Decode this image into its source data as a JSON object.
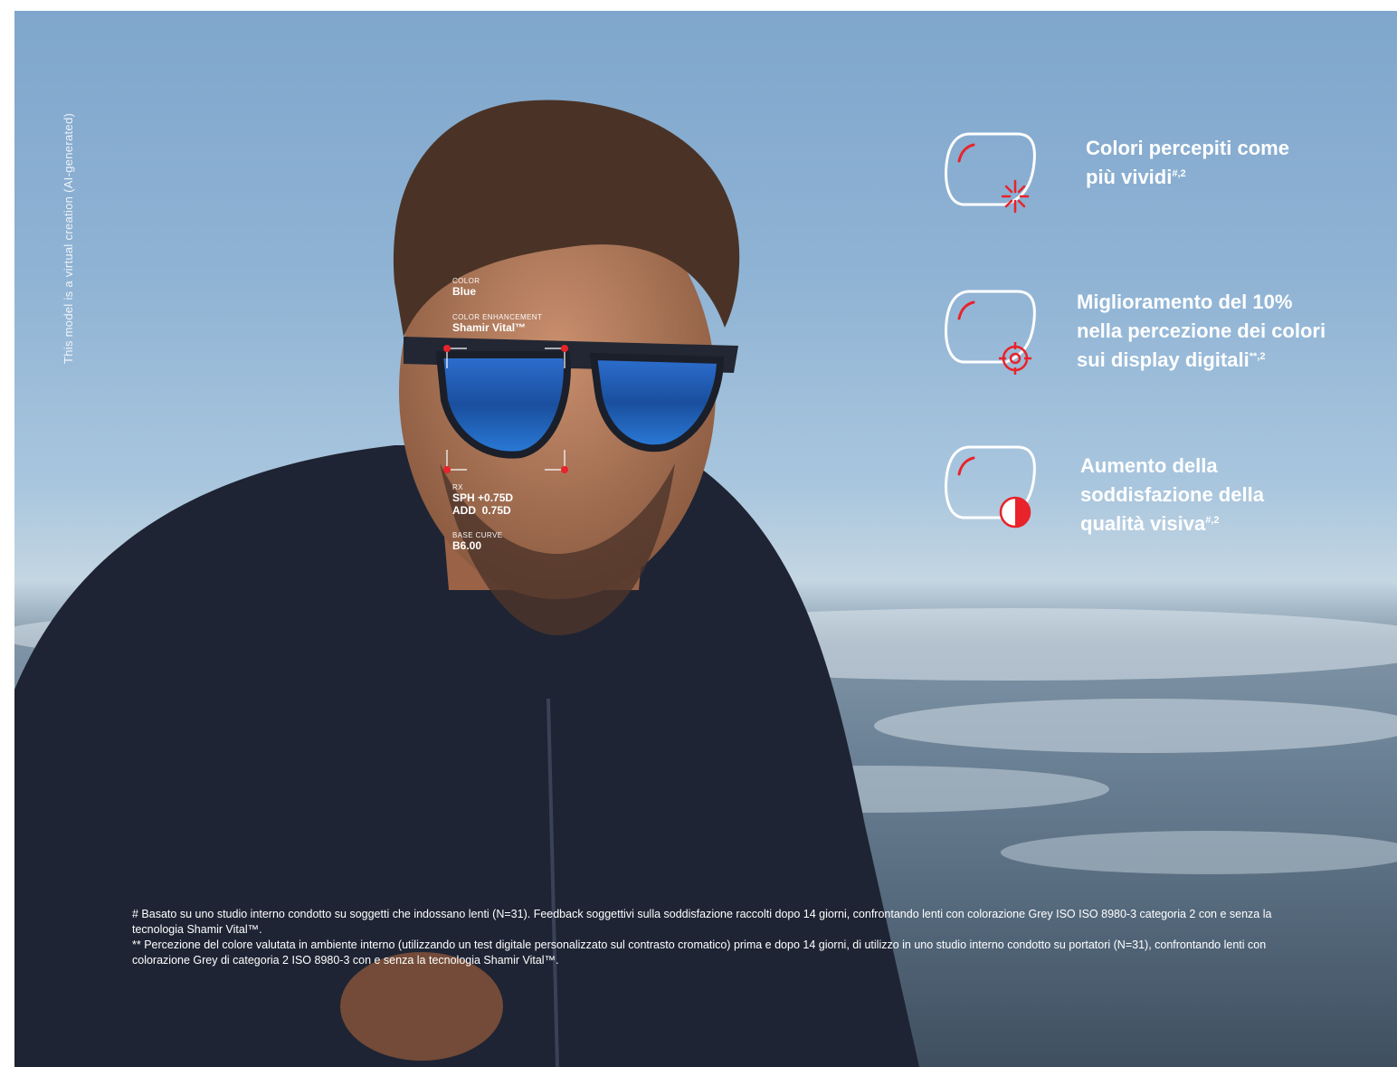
{
  "disclaimer": "This model is a virtual creation (AI-generated)",
  "lens_specs": {
    "color_label": "COLOR",
    "color_value": "Blue",
    "enhancement_label": "COLOR ENHANCEMENT",
    "enhancement_value": "Shamir Vital™",
    "rx_label": "RX",
    "sph_value": "SPH +0.75D",
    "add_value": "ADD  0.75D",
    "base_curve_label": "BASE CURVE",
    "base_curve_value": "B6.00"
  },
  "features": [
    {
      "icon": "vivid-colors-icon",
      "lines": [
        "Colori percepiti come",
        "più vividi"
      ],
      "sup": "#,2"
    },
    {
      "icon": "target-icon",
      "lines": [
        "Miglioramento del 10%",
        "nella percezione dei colori",
        "sui display digitali"
      ],
      "sup": "**,2"
    },
    {
      "icon": "contrast-icon",
      "lines": [
        "Aumento della",
        "soddisfazione della",
        "qualità visiva"
      ],
      "sup": "#,2"
    }
  ],
  "footnotes": {
    "note1": "# Basato su uno studio interno condotto su soggetti che indossano lenti (N=31). Feedback soggettivi sulla soddisfazione raccolti dopo 14 giorni, confrontando lenti con colorazione Grey ISO ISO 8980-3 categoria  2 con e senza la tecnologia Shamir Vital™.",
    "note2": "** Percezione del colore valutata in ambiente interno (utilizzando un test digitale personalizzato sul contrasto cromatico) prima e dopo 14 giorni, di utilizzo in uno studio interno condotto su portatori (N=31), confrontando lenti con colorazione Grey di categoria 2  ISO 8980-3 con e senza la tecnologia Shamir Vital™."
  },
  "colors": {
    "accent": "#e8232a",
    "text": "#ffffff",
    "sky": "#8fb3d4",
    "lens": "#1f5fb8"
  }
}
